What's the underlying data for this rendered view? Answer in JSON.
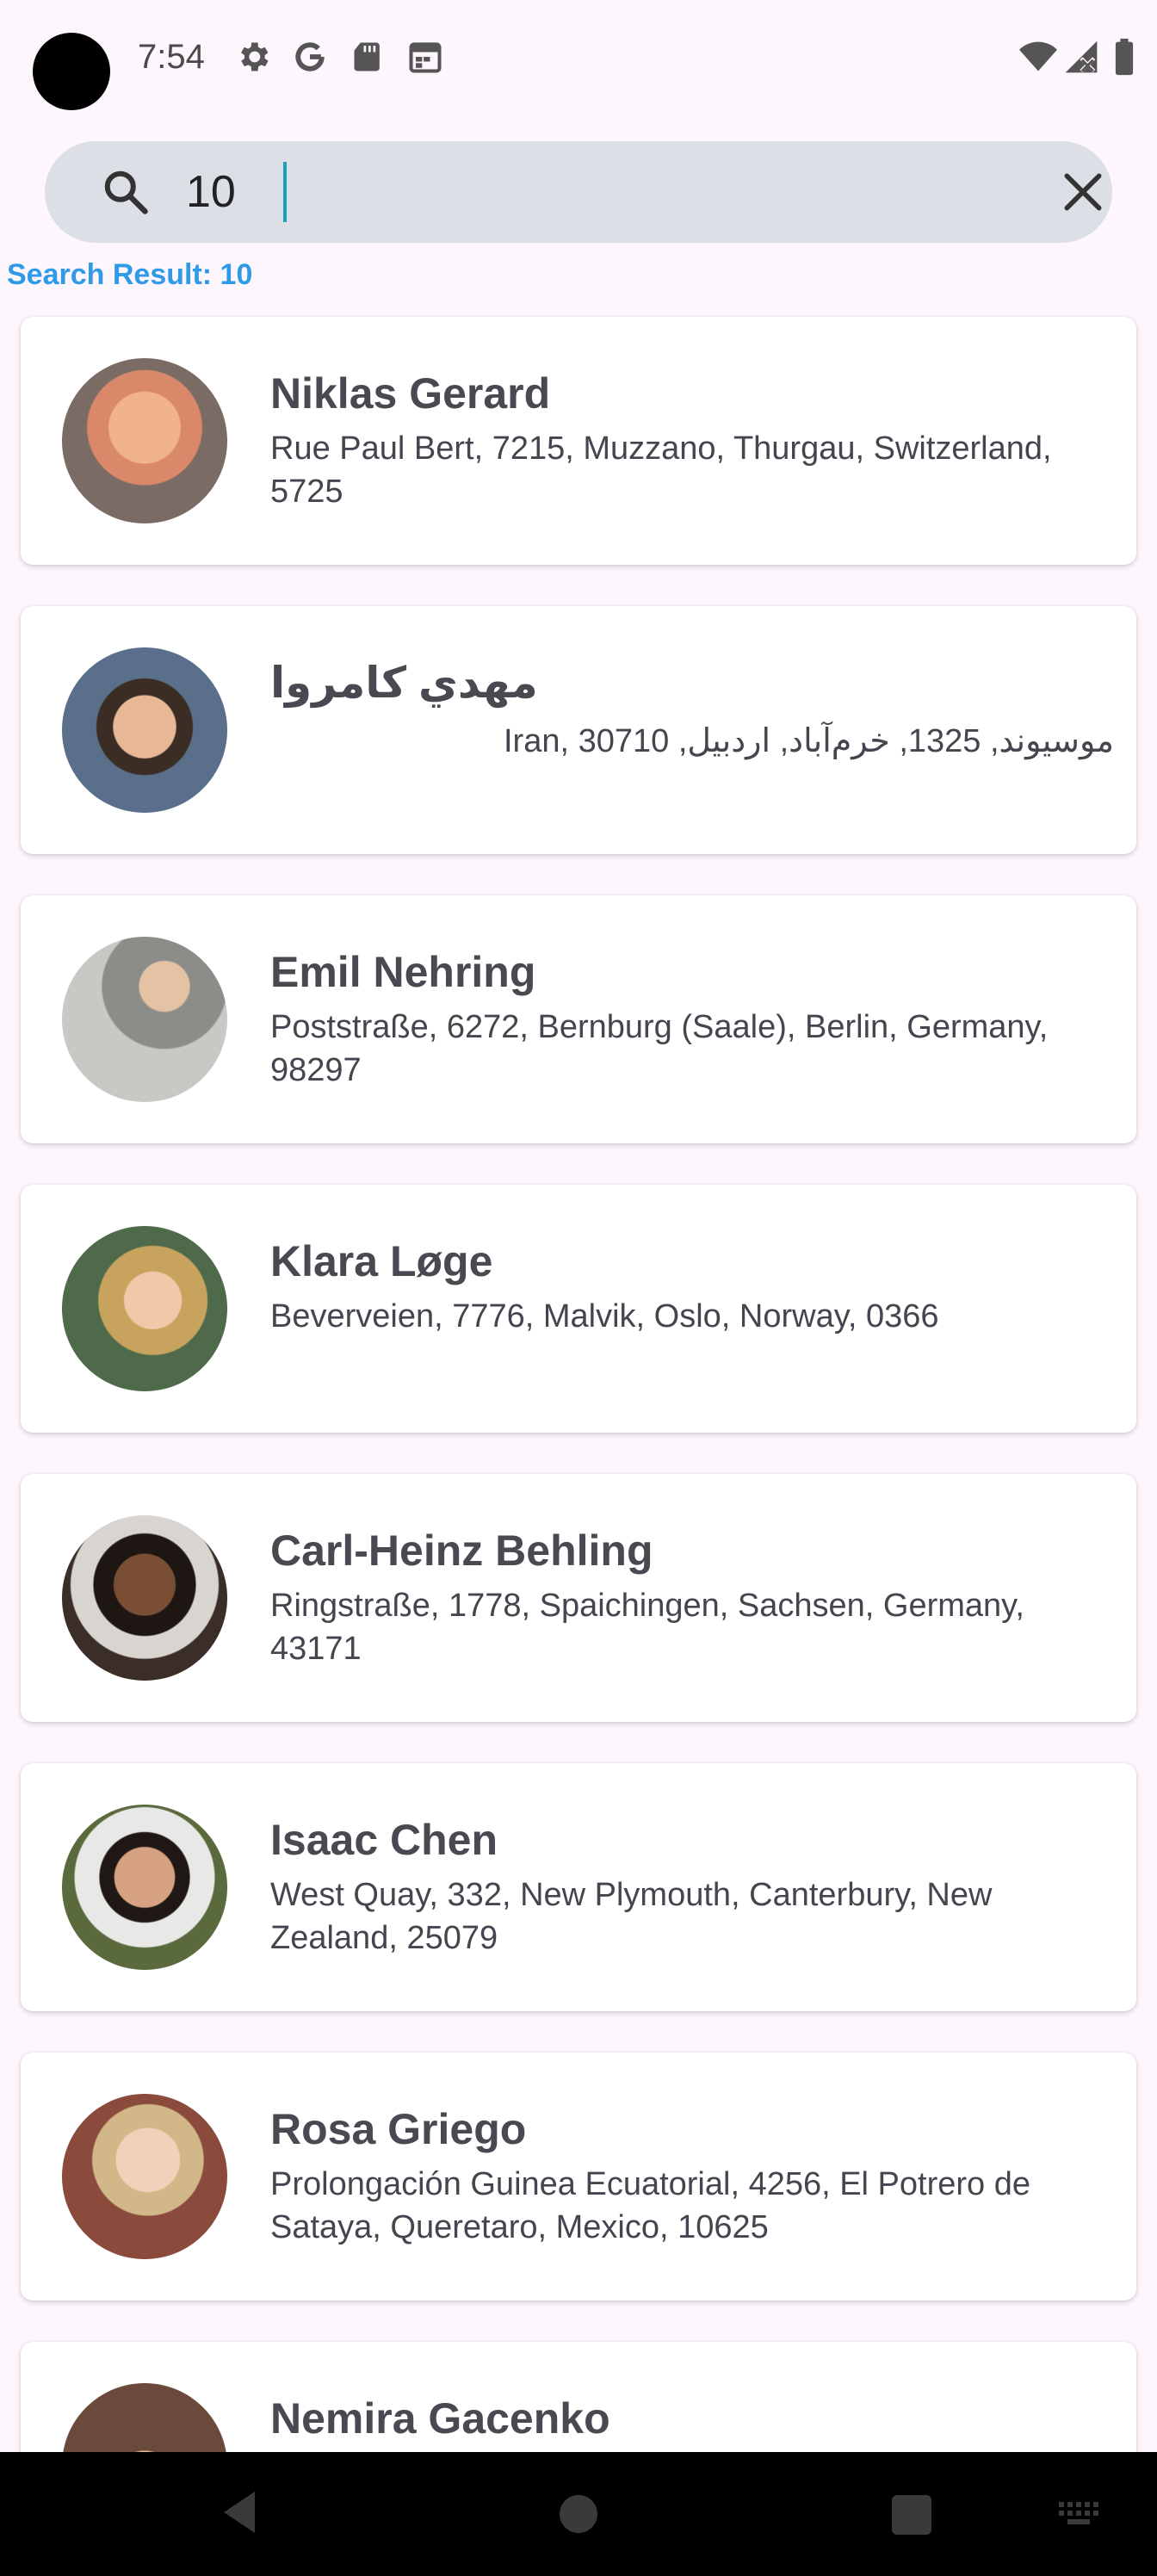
{
  "status_bar": {
    "time": "7:54",
    "icons_left": [
      "settings-icon",
      "google-icon",
      "sd-card-icon",
      "calendar-icon"
    ],
    "icons_right": [
      "wifi-icon",
      "signal-off-icon",
      "battery-icon"
    ]
  },
  "search": {
    "value": "10",
    "placeholder": "",
    "search_icon": "search-icon",
    "clear_icon": "close-icon"
  },
  "results": {
    "label": "Search Result:",
    "count": "10"
  },
  "contacts": [
    {
      "name": "Niklas Gerard",
      "address": "Rue Paul Bert, 7215, Muzzano, Thurgau, Switzerland, 5725",
      "avatar_color": "#d9886a"
    },
    {
      "name": "مهدي كامروا",
      "address": "موسیوند, 1325, خرم‌آباد, اردبیل, Iran, 30710",
      "avatar_color": "#5a6f8a"
    },
    {
      "name": "Emil Nehring",
      "address": "Poststraße, 6272, Bernburg (Saale), Berlin, Germany, 98297",
      "avatar_color": "#9a9a96"
    },
    {
      "name": "Klara Løge",
      "address": "Beverveien, 7776, Malvik, Oslo, Norway, 0366",
      "avatar_color": "#b79a5e"
    },
    {
      "name": "Carl-Heinz Behling",
      "address": "Ringstraße, 1778, Spaichingen, Sachsen, Germany, 43171",
      "avatar_color": "#3b2e28"
    },
    {
      "name": "Isaac Chen",
      "address": "West Quay, 332, New Plymouth, Canterbury, New Zealand, 25079",
      "avatar_color": "#5a6a3c"
    },
    {
      "name": "Rosa Griego",
      "address": "Prolongación Guinea Ecuatorial, 4256, El Potrero de Sataya, Queretaro, Mexico, 10625",
      "avatar_color": "#8a4a3c"
    },
    {
      "name": "Nemira Gacenko",
      "address": "",
      "avatar_color": "#6a4a3a"
    }
  ],
  "nav_bar": {
    "icons": [
      "back-icon",
      "home-icon",
      "recents-icon",
      "keyboard-icon"
    ]
  }
}
